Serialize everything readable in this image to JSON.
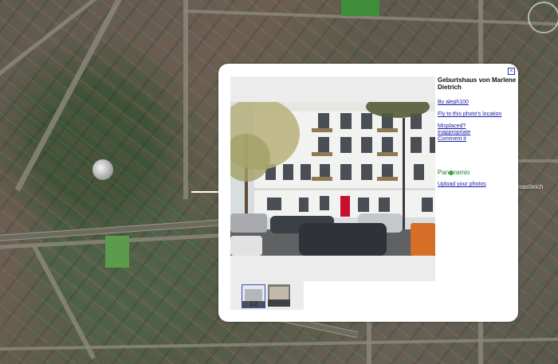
{
  "map": {
    "side_label": "nastleich"
  },
  "balloon": {
    "title": "Geburtshaus von Marlene Dietrich",
    "author_link": "By aleph100",
    "fly_link": "Fly to this photo's location",
    "misplaced_link": "Misplaced?",
    "inappropriate_link": "Inappropriate",
    "comment_link": "Comment it",
    "logo_text_left": "Pan",
    "logo_text_right": "ramio",
    "upload_link": "Upload your photos",
    "thumb_counter": "1/2",
    "close_icon": "×"
  },
  "colors": {
    "link": "#1a1aa6",
    "logo": "#2c7c2c",
    "thumb_highlight": "#3850c8"
  }
}
